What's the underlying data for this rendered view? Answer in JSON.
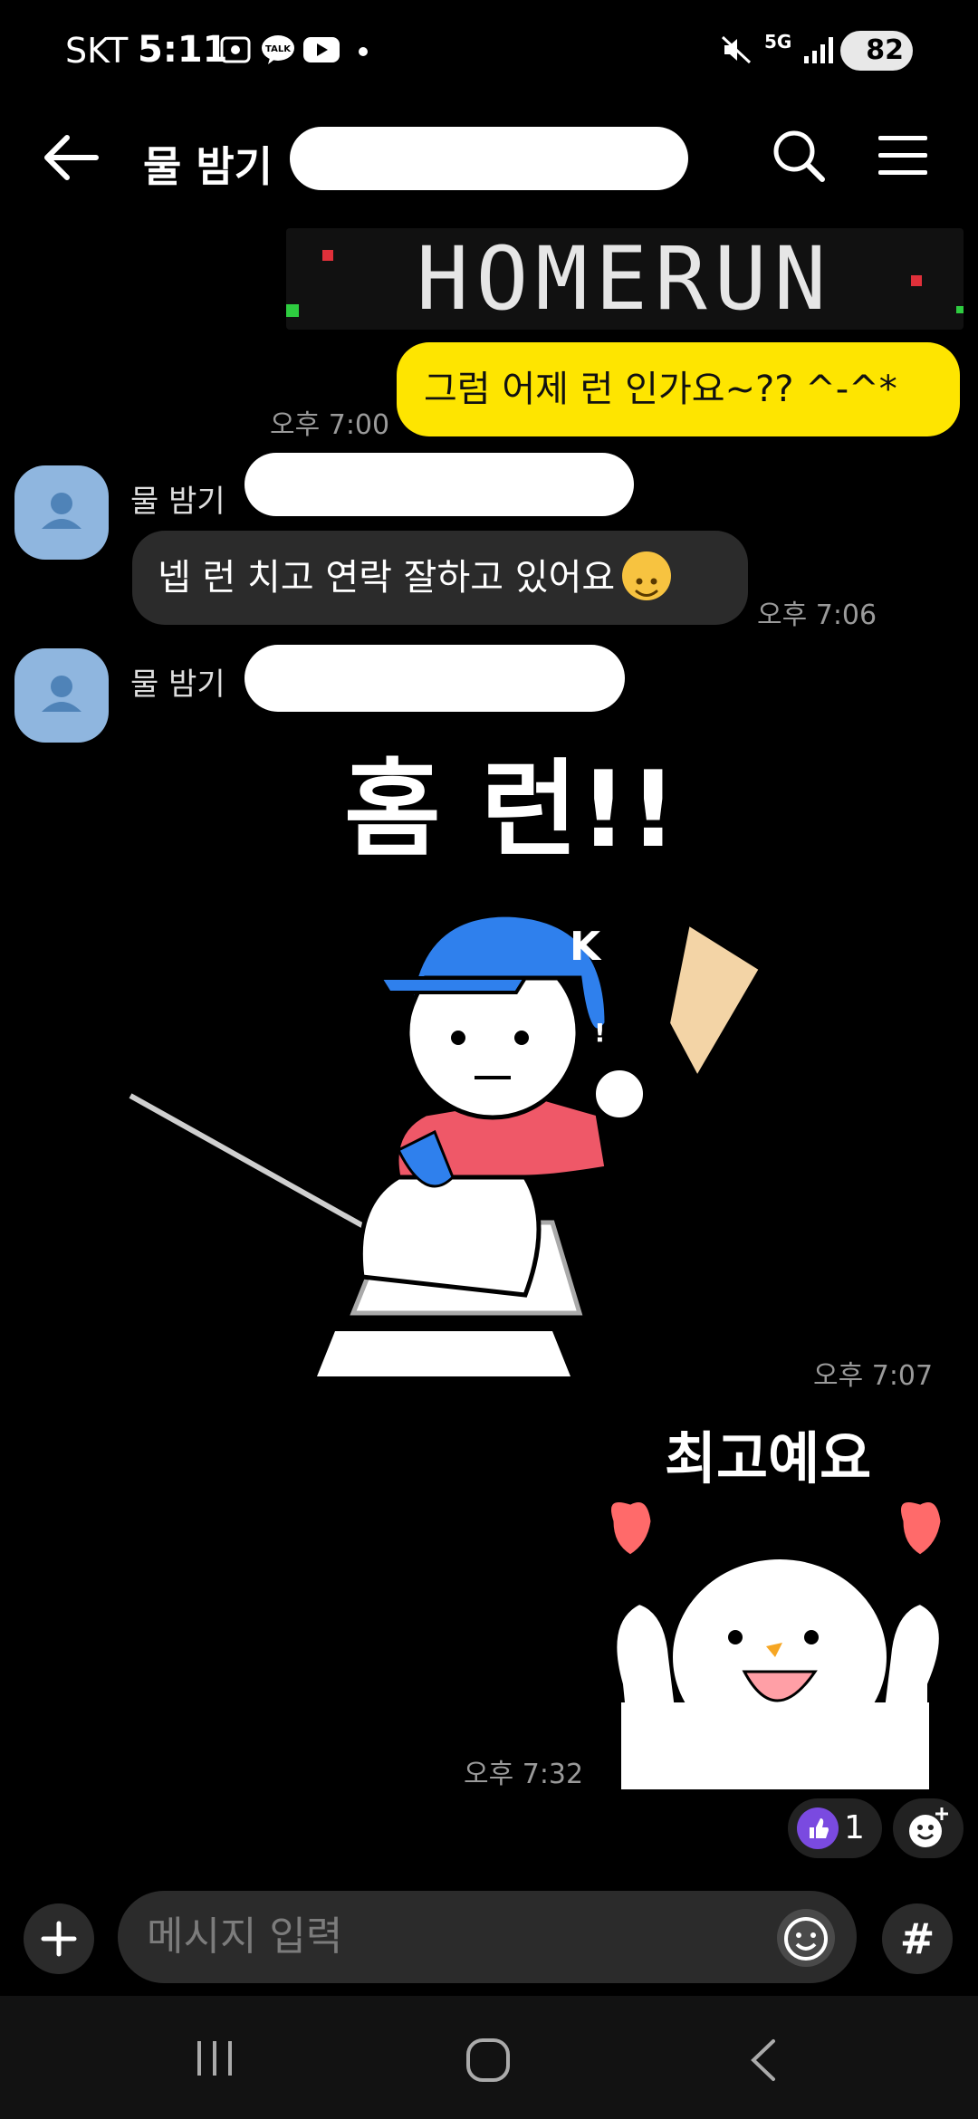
{
  "status_bar": {
    "carrier": "SKT",
    "time": "5:11",
    "talk_badge": "TALK",
    "network": "5G",
    "battery": "82"
  },
  "header": {
    "title": "물 밤기"
  },
  "messages": {
    "homerun_banner": "HOMERUN",
    "outgoing_1": {
      "text": "그럼 어제 런 인가요~??  ^-^*",
      "time": "오후 7:00"
    },
    "incoming_1": {
      "sender": "물 밤기",
      "text": "넵 런 치고 연락 잘하고 있어요",
      "time": "오후 7:06"
    },
    "incoming_2": {
      "sender": "물 밤기",
      "sticker_text": "홈 런!!",
      "sticker_badge": "K",
      "time": "오후 7:07"
    },
    "outgoing_2": {
      "sticker_text": "최고예요",
      "time": "오후 7:32"
    }
  },
  "reactions": {
    "count": "1"
  },
  "input": {
    "placeholder": "메시지 입력",
    "hash_label": "#"
  },
  "colors": {
    "bubble_me": "#fee500",
    "bubble_other": "#2b2b2b",
    "avatar": "#8fb6df",
    "react": "#7a4ae0"
  },
  "icons": [
    "back-arrow-icon",
    "search-icon",
    "hamburger-menu-icon",
    "plus-icon",
    "emoji-icon",
    "hash-icon",
    "thumbs-up-icon",
    "add-reaction-icon"
  ]
}
